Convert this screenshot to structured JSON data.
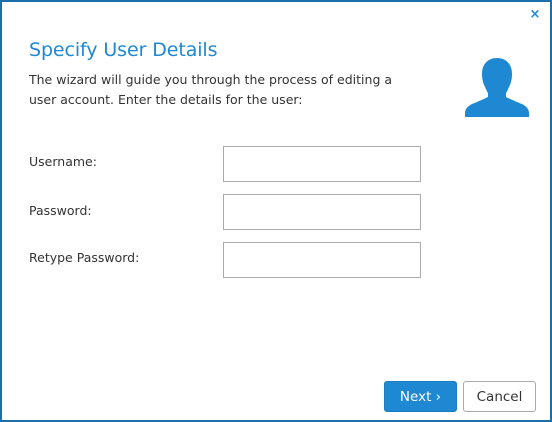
{
  "dialog": {
    "close_glyph": "×",
    "title": "Specify User Details",
    "intro": "The wizard will guide you through the process of editing a user account. Enter the details for the user:",
    "accent_color": "#1f88d2",
    "icon": "user-silhouette-icon"
  },
  "form": {
    "username": {
      "label": "Username:",
      "value": "",
      "placeholder": ""
    },
    "password": {
      "label": "Password:",
      "value": "",
      "placeholder": ""
    },
    "retype_password": {
      "label": "Retype Password:",
      "value": "",
      "placeholder": ""
    }
  },
  "buttons": {
    "next_label": "Next ›",
    "cancel_label": "Cancel"
  }
}
